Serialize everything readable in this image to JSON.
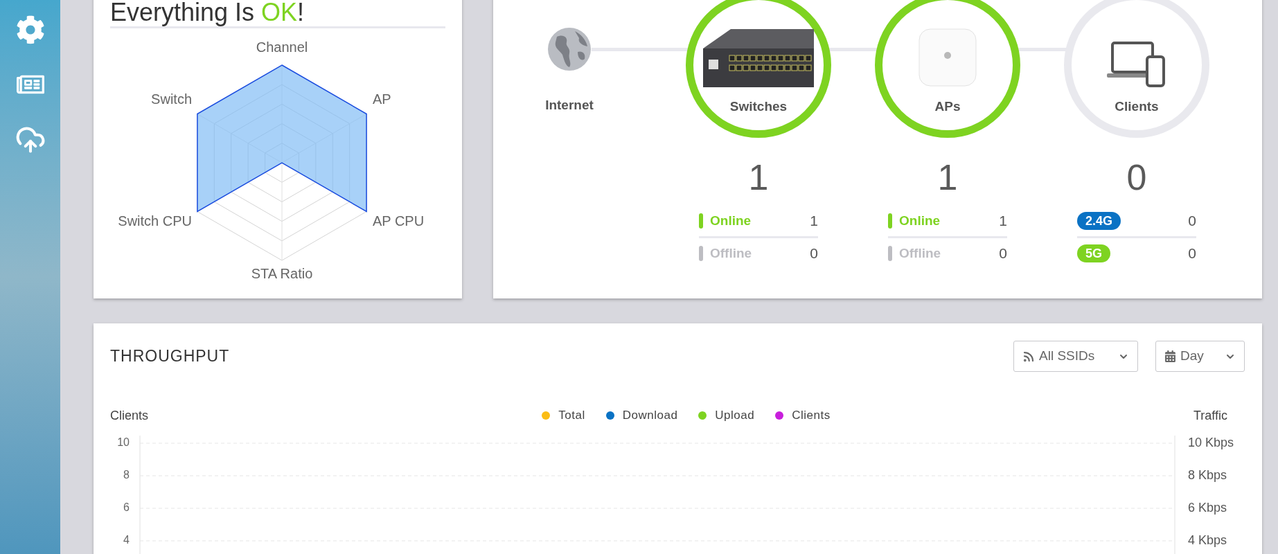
{
  "health": {
    "title": {
      "prefix": "Everything Is ",
      "status": "OK",
      "suffix": "!"
    },
    "radar_axes": [
      "Channel",
      "AP",
      "AP CPU",
      "STA Ratio",
      "Switch CPU",
      "Switch"
    ]
  },
  "topology": {
    "nodes": [
      {
        "kind": "globe",
        "label": "Internet"
      },
      {
        "kind": "switch",
        "label": "Switches",
        "healthy": true,
        "count": "1",
        "rows": [
          {
            "kind": "status",
            "label": "Online",
            "color": "#7ed321",
            "count": "1"
          },
          {
            "kind": "status",
            "label": "Offline",
            "color": "#bdbdc2",
            "count": "0"
          }
        ]
      },
      {
        "kind": "ap",
        "label": "APs",
        "healthy": true,
        "count": "1",
        "rows": [
          {
            "kind": "status",
            "label": "Online",
            "color": "#7ed321",
            "count": "1"
          },
          {
            "kind": "status",
            "label": "Offline",
            "color": "#bdbdc2",
            "count": "0"
          }
        ]
      },
      {
        "kind": "clients",
        "label": "Clients",
        "healthy": false,
        "count": "0",
        "rows": [
          {
            "kind": "band",
            "label": "2.4G",
            "color": "#0a72c4",
            "count": "0"
          },
          {
            "kind": "band",
            "label": "5G",
            "color": "#7ed321",
            "count": "0"
          }
        ]
      }
    ]
  },
  "throughput": {
    "title": "THROUGHPUT",
    "filters": [
      {
        "kind": "ssid",
        "value": "All SSIDs"
      },
      {
        "kind": "period",
        "value": "Day"
      }
    ],
    "chart_data": {
      "type": "line",
      "ylabel": "Clients",
      "ylim": [
        2.8,
        10
      ],
      "grid": true,
      "yticks": [
        4,
        6,
        8,
        10
      ],
      "series": [
        {
          "name": "Total",
          "color": "#fbbd16"
        },
        {
          "name": "Download",
          "color": "#0a72c4"
        },
        {
          "name": "Upload",
          "color": "#7ed321"
        },
        {
          "name": "Clients",
          "color": "#c81fdc"
        }
      ]
    },
    "right_axis": {
      "label": "Traffic",
      "ticks": [
        "10 Kbps",
        "8 Kbps",
        "6 Kbps",
        "4 Kbps"
      ]
    }
  }
}
